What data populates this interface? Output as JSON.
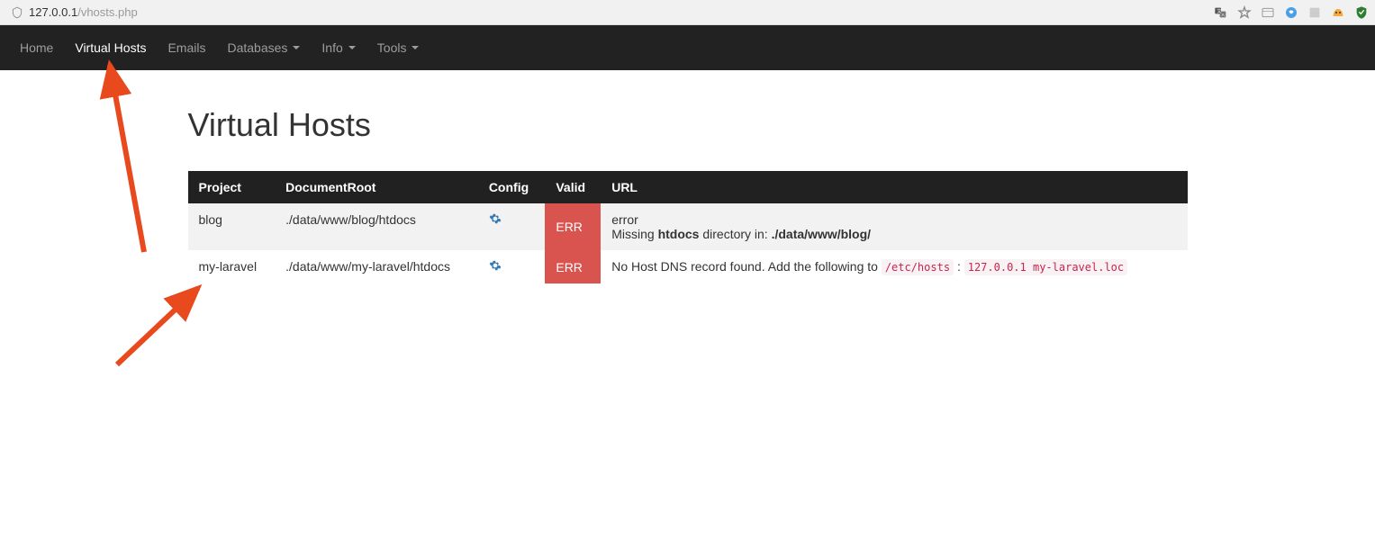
{
  "browser": {
    "url_host": "127.0.0.1",
    "url_path": "/vhosts.php"
  },
  "nav": {
    "items": [
      {
        "label": "Home",
        "active": false,
        "dropdown": false
      },
      {
        "label": "Virtual Hosts",
        "active": true,
        "dropdown": false
      },
      {
        "label": "Emails",
        "active": false,
        "dropdown": false
      },
      {
        "label": "Databases",
        "active": false,
        "dropdown": true
      },
      {
        "label": "Info",
        "active": false,
        "dropdown": true
      },
      {
        "label": "Tools",
        "active": false,
        "dropdown": true
      }
    ]
  },
  "page": {
    "title": "Virtual Hosts"
  },
  "table": {
    "headers": [
      "Project",
      "DocumentRoot",
      "Config",
      "Valid",
      "URL"
    ],
    "rows": [
      {
        "project": "blog",
        "docroot": "./data/www/blog/htdocs",
        "valid": "ERR",
        "url_line1": "error",
        "url_line2_pre": "Missing ",
        "url_line2_bold": "htdocs",
        "url_line2_mid": " directory in: ",
        "url_line2_bold2": "./data/www/blog/"
      },
      {
        "project": "my-laravel",
        "docroot": "./data/www/my-laravel/htdocs",
        "valid": "ERR",
        "url_text_pre": "No Host DNS record found. Add the following to ",
        "url_code1": "/etc/hosts",
        "url_text_mid": " : ",
        "url_code2": "127.0.0.1 my-laravel.loc"
      }
    ]
  }
}
